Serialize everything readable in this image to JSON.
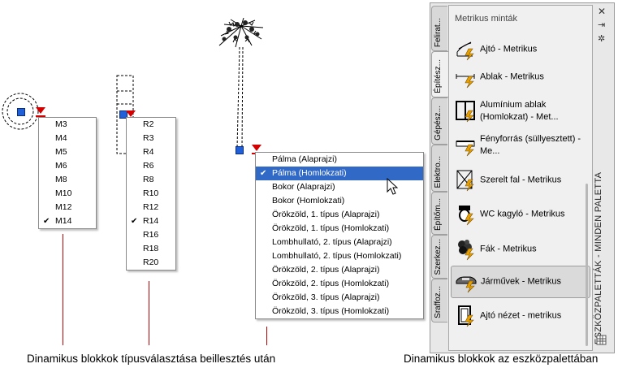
{
  "menus": {
    "metric_sizes": [
      {
        "label": "M3",
        "checked": false
      },
      {
        "label": "M4",
        "checked": false
      },
      {
        "label": "M5",
        "checked": false
      },
      {
        "label": "M6",
        "checked": false
      },
      {
        "label": "M8",
        "checked": false
      },
      {
        "label": "M10",
        "checked": false
      },
      {
        "label": "M12",
        "checked": false
      },
      {
        "label": "M14",
        "checked": true
      }
    ],
    "r_sizes": [
      {
        "label": "R2",
        "checked": false
      },
      {
        "label": "R3",
        "checked": false
      },
      {
        "label": "R4",
        "checked": false
      },
      {
        "label": "R6",
        "checked": false
      },
      {
        "label": "R8",
        "checked": false
      },
      {
        "label": "R10",
        "checked": false
      },
      {
        "label": "R12",
        "checked": false
      },
      {
        "label": "R14",
        "checked": true
      },
      {
        "label": "R16",
        "checked": false
      },
      {
        "label": "R18",
        "checked": false
      },
      {
        "label": "R20",
        "checked": false
      }
    ],
    "plant_types": [
      {
        "label": "Pálma (Alaprajzi)",
        "checked": false,
        "selected": false
      },
      {
        "label": "Pálma (Homlokzati)",
        "checked": true,
        "selected": true
      },
      {
        "label": "Bokor (Alaprajzi)",
        "checked": false,
        "selected": false
      },
      {
        "label": "Bokor (Homlokzati)",
        "checked": false,
        "selected": false
      },
      {
        "label": "Örökzöld, 1. típus (Alaprajzi)",
        "checked": false,
        "selected": false
      },
      {
        "label": "Örökzöld, 1. típus (Homlokzati)",
        "checked": false,
        "selected": false
      },
      {
        "label": "Lombhullató, 2. típus (Alaprajzi)",
        "checked": false,
        "selected": false
      },
      {
        "label": "Lombhullató, 2. típus (Homlokzati)",
        "checked": false,
        "selected": false
      },
      {
        "label": "Örökzöld, 2. típus (Alaprajzi)",
        "checked": false,
        "selected": false
      },
      {
        "label": "Örökzöld, 2. típus (Homlokzati)",
        "checked": false,
        "selected": false
      },
      {
        "label": "Örökzöld, 3. típus (Alaprajzi)",
        "checked": false,
        "selected": false
      },
      {
        "label": "Örökzöld, 3. típus (Homlokzati)",
        "checked": false,
        "selected": false
      }
    ]
  },
  "captions": {
    "left": "Dinamikus blokkok  típusválasztása beillesztés után",
    "right": "Dinamikus blokkok az eszközpalettában"
  },
  "palette": {
    "vertical_title": "ESZKÖZPALETTÁK - MINDEN PALETTA",
    "section_title": "Metrikus minták",
    "controls": {
      "close": "✕",
      "autohide": "⇥",
      "properties": "✲"
    },
    "tabs": [
      "Felirat...",
      "Építész...",
      "Gépész...",
      "Elektro...",
      "Építőm...",
      "Szerkez...",
      "Sraffoz..."
    ],
    "active_tab": 1,
    "items": [
      {
        "label": "Ajtó - Metrikus",
        "icon": "door-icon"
      },
      {
        "label": "Ablak - Metrikus",
        "icon": "window-icon"
      },
      {
        "label": "Alumínium ablak (Homlokzat) - Met...",
        "icon": "aluminium-window-icon"
      },
      {
        "label": "Fényforrás (süllyesztett) - Me...",
        "icon": "light-fixture-icon"
      },
      {
        "label": "Szerelt fal - Metrikus",
        "icon": "stud-wall-icon"
      },
      {
        "label": "WC kagyló - Metrikus",
        "icon": "toilet-icon"
      },
      {
        "label": "Fák - Metrikus",
        "icon": "tree-icon"
      },
      {
        "label": "Járművek - Metrikus",
        "icon": "vehicle-icon"
      },
      {
        "label": "Ajtó nézet - metrikus",
        "icon": "door-elevation-icon"
      }
    ],
    "highlighted_item": 7
  }
}
